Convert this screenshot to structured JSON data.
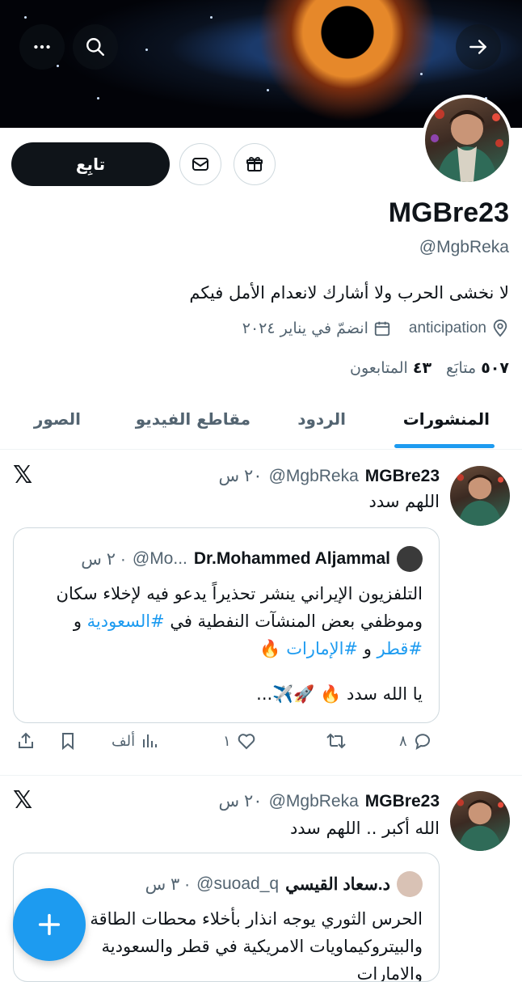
{
  "profile": {
    "display_name": "MGBre23",
    "handle": "@MgbReka",
    "bio": "لا نخشى الحرب ولا أشارك لانعدام الأمل فيكم",
    "location": "anticipation",
    "joined": "انضمّ في يناير ٢٠٢٤",
    "following_count": "٥٠٧",
    "following_label": "متابَع",
    "followers_count": "٤٣",
    "followers_label": "المتابعون",
    "follow_label": "تابِع"
  },
  "tabs": [
    {
      "label": "المنشورات",
      "active": true
    },
    {
      "label": "الردود",
      "active": false
    },
    {
      "label": "مقاطع الفيديو",
      "active": false
    },
    {
      "label": "الصور",
      "active": false
    }
  ],
  "tweets": [
    {
      "name": "MGBre23",
      "handle": "@MgbReka",
      "time": "٢٠ س",
      "text": "اللهم سدد",
      "quote": {
        "name": "Dr.Mohammed Aljammal",
        "handle": "@Mo...",
        "time": "٢ س ·",
        "line1": "التلفزيون الإيراني ينشر تحذيراً يدعو فيه لإخلاء سكان",
        "line2_pre": "وموظفي بعض المنشآت النفطية في",
        "line2_tag": "#السعودية",
        "line2_post": "و",
        "line3_tag1": "#قطر",
        "line3_mid": "و",
        "line3_tag2": "#الإمارات",
        "line3_emoji": "🔥",
        "line4": "يا الله سدد 🔥 🚀✈️..."
      },
      "actions": {
        "replies": "٨",
        "retweets": "",
        "likes": "١",
        "views": "ألف"
      }
    },
    {
      "name": "MGBre23",
      "handle": "@MgbReka",
      "time": "٢٠ س",
      "text": "الله أكبر .. اللهم سدد",
      "quote": {
        "name": "د.سعاد القيسي",
        "handle": "@suoad_q",
        "time": "٣ س ·",
        "line1": "الحرس الثوري يوجه انذار بأخلاء محطات الطاقة",
        "line2": "والبيتروكيماويات الامريكية في قطر والسعودية",
        "line3": "والامارات"
      }
    }
  ],
  "icons": {
    "back": "arrow-right-icon",
    "search": "search-icon",
    "more": "more-icon"
  },
  "colors": {
    "accent": "#1d9bf0",
    "text": "#0f1419",
    "muted": "#536471"
  }
}
